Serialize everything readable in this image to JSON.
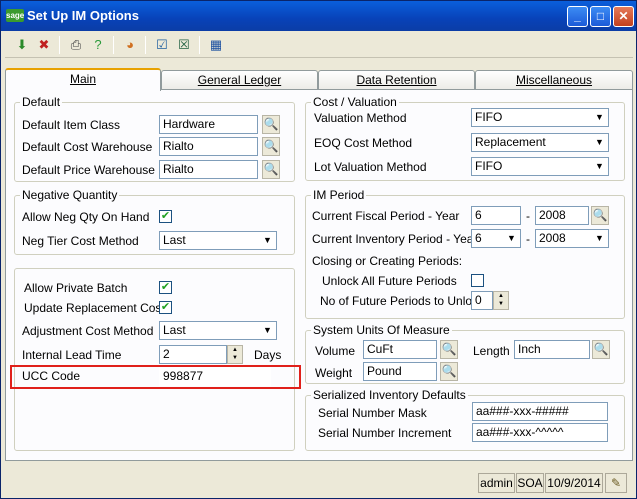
{
  "window": {
    "title": "Set Up IM Options",
    "logo_text": "sage",
    "controls": {
      "minimize": "_",
      "maximize": "□",
      "close": "✕"
    }
  },
  "toolbar": {
    "icons": [
      "accept-icon",
      "cancel-icon",
      "print-icon",
      "help-icon",
      "color-wheel-icon",
      "checklist-icon",
      "checklist-x-icon",
      "calendar-grid-icon"
    ]
  },
  "tabs": [
    {
      "label": "Main"
    },
    {
      "label": "General Ledger"
    },
    {
      "label": "Data Retention"
    },
    {
      "label": "Miscellaneous"
    }
  ],
  "default_group": {
    "title": "Default",
    "item_class_label": "Default Item Class",
    "item_class_value": "Hardware",
    "cost_warehouse_label": "Default Cost Warehouse",
    "cost_warehouse_value": "Rialto",
    "price_warehouse_label": "Default Price Warehouse",
    "price_warehouse_value": "Rialto"
  },
  "negative_qty_group": {
    "title": "Negative Quantity",
    "allow_neg_label": "Allow Neg Qty On Hand",
    "allow_neg_checked": true,
    "neg_tier_label": "Neg Tier Cost Method",
    "neg_tier_value": "Last"
  },
  "misc_group": {
    "allow_private_batch_label": "Allow Private Batch",
    "allow_private_batch_checked": true,
    "update_replacement_label": "Update Replacement Cost",
    "update_replacement_checked": true,
    "adjustment_cost_label": "Adjustment Cost Method",
    "adjustment_cost_value": "Last",
    "lead_time_label": "Internal Lead Time",
    "lead_time_value": "2",
    "lead_time_unit": "Days",
    "ucc_label": "UCC Code",
    "ucc_value": "998877"
  },
  "cost_valuation_group": {
    "title": "Cost / Valuation",
    "valuation_label": "Valuation Method",
    "valuation_value": "FIFO",
    "eoq_label": "EOQ Cost Method",
    "eoq_value": "Replacement",
    "lot_label": "Lot Valuation Method",
    "lot_value": "FIFO"
  },
  "im_period_group": {
    "title": "IM Period",
    "fiscal_label": "Current Fiscal Period - Year",
    "fiscal_period": "6",
    "fiscal_year": "2008",
    "inventory_label": "Current Inventory Period - Year",
    "inventory_period": "6",
    "inventory_year": "2008",
    "dash": "-",
    "closing_label": "Closing or Creating Periods:",
    "unlock_label": "Unlock All Future Periods",
    "unlock_checked": false,
    "future_periods_label": "No of Future Periods to Unlock",
    "future_periods_value": "0"
  },
  "units_group": {
    "title": "System Units Of Measure",
    "volume_label": "Volume",
    "volume_value": "CuFt",
    "length_label": "Length",
    "length_value": "Inch",
    "weight_label": "Weight",
    "weight_value": "Pound"
  },
  "serialized_group": {
    "title": "Serialized Inventory Defaults",
    "mask_label": "Serial Number Mask",
    "mask_value": "aa###-xxx-#####",
    "increment_label": "Serial Number Increment",
    "increment_value": "aa###-xxx-^^^^^"
  },
  "statusbar": {
    "user": "admin",
    "company": "SOA",
    "date": "10/9/2014"
  }
}
